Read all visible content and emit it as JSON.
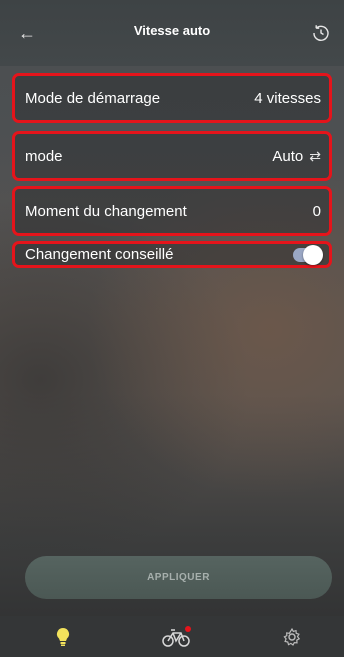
{
  "header": {
    "title": "Vitesse auto",
    "back_icon": "arrow-left-icon",
    "history_icon": "history-icon"
  },
  "settings": [
    {
      "label": "Mode de démarrage",
      "value": "4 vitesses"
    },
    {
      "label": "mode",
      "value": "Auto",
      "icon": "swap-arrows-icon"
    },
    {
      "label": "Moment du changement",
      "value": "0"
    },
    {
      "label": "Changement conseillé",
      "toggle_on": true
    }
  ],
  "apply_button": {
    "label": "APPLIQUER",
    "enabled": false
  },
  "bottom_nav": {
    "items": [
      {
        "icon": "lightbulb-icon",
        "active": true
      },
      {
        "icon": "bicycle-icon",
        "has_notification": true
      },
      {
        "icon": "gear-icon"
      }
    ]
  },
  "colors": {
    "highlight_border": "#e5141b",
    "active_icon": "#f2e25c",
    "toggle_track": "#9aa7c4",
    "notification_dot": "#e5141b"
  }
}
